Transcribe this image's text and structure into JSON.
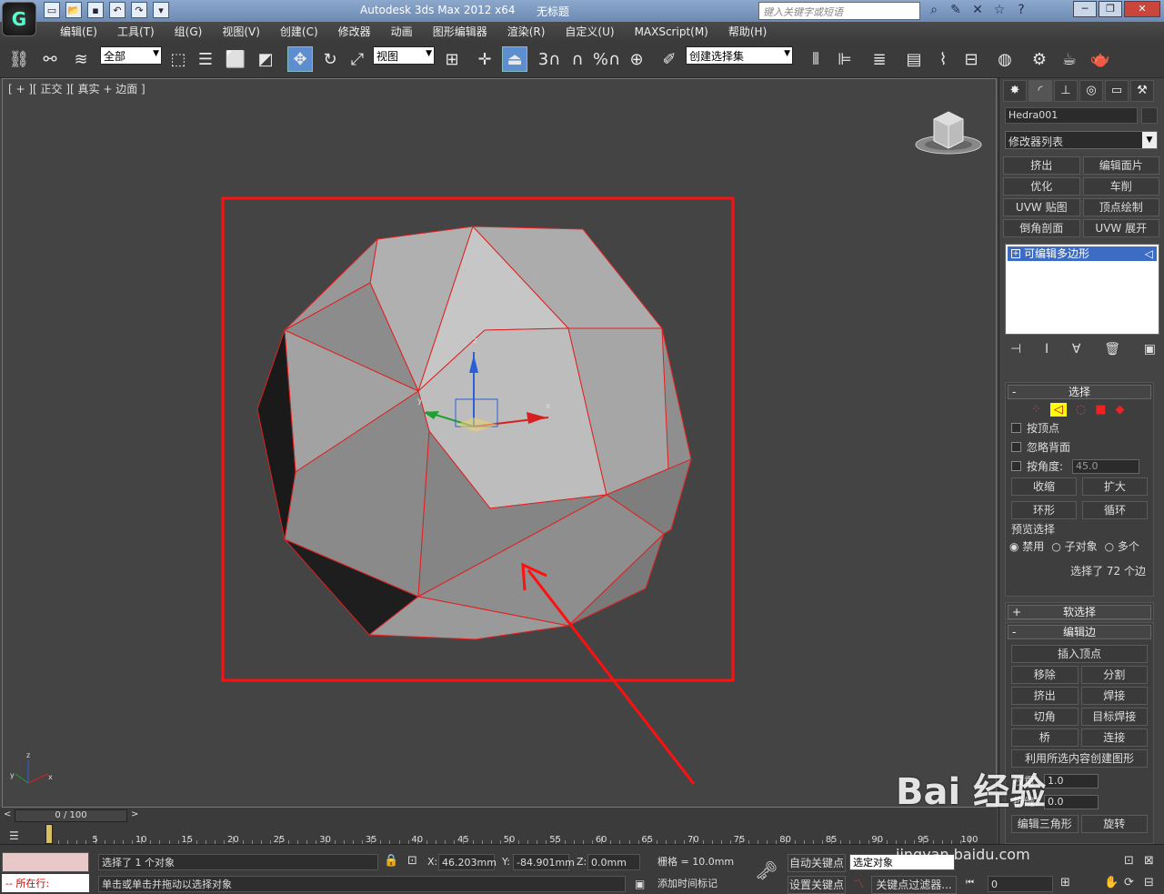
{
  "app": {
    "title": "Autodesk 3ds Max  2012 x64",
    "document": "无标题",
    "search_placeholder": "键入关键字或短语"
  },
  "menu": [
    "编辑(E)",
    "工具(T)",
    "组(G)",
    "视图(V)",
    "创建(C)",
    "修改器",
    "动画",
    "图形编辑器",
    "渲染(R)",
    "自定义(U)",
    "MAXScript(M)",
    "帮助(H)"
  ],
  "toolbar": {
    "filter": "全部",
    "refcoord": "视图",
    "selset": "创建选择集",
    "snap_num": "3",
    "angle": "%"
  },
  "viewport": {
    "label": "[ + ][ 正交 ][ 真实 + 边面 ]"
  },
  "panel": {
    "object_name": "Hedra001",
    "modifier_list": "修改器列表",
    "mod_buttons": [
      "挤出",
      "编辑面片",
      "优化",
      "车削",
      "UVW 贴图",
      "顶点绘制",
      "倒角剖面",
      "UVW 展开"
    ],
    "stack_item": "可编辑多边形",
    "selection": {
      "title": "选择",
      "by_vertex": "按顶点",
      "ignore_back": "忽略背面",
      "by_angle": "按角度:",
      "angle_value": "45.0",
      "shrink": "收缩",
      "grow": "扩大",
      "ring": "环形",
      "loop": "循环",
      "preview": "预览选择",
      "disable": "禁用",
      "subobj": "子对象",
      "multi": "多个",
      "status": "选择了 72 个边"
    },
    "soft_sel": "软选择",
    "edit_edges": {
      "title": "编辑边",
      "insert_vertex": "插入顶点",
      "remove": "移除",
      "split": "分割",
      "extrude": "挤出",
      "weld": "焊接",
      "chamfer": "切角",
      "target_weld": "目标焊接",
      "bridge": "桥",
      "connect": "连接",
      "create_shape": "利用所选内容创建图形",
      "weight": "权重:",
      "weight_value": "1.0",
      "crease": "折缝:",
      "crease_value": "0.0",
      "edit_tri": "编辑三角形",
      "turn": "旋转"
    }
  },
  "timeline": {
    "frame": "0 / 100",
    "ticks": [
      "0",
      "5",
      "10",
      "15",
      "20",
      "25",
      "30",
      "35",
      "40",
      "45",
      "50",
      "55",
      "60",
      "65",
      "70",
      "75",
      "80",
      "85",
      "90",
      "95",
      "100"
    ]
  },
  "status": {
    "selected": "选择了 1 个对象",
    "prompt": "单击或单击并拖动以选择对象",
    "current_label": "所在行:",
    "x": "46.203mm",
    "y": "-84.901mm",
    "z": "0.0mm",
    "grid": "栅格 = 10.0mm",
    "autokey": "自动关键点",
    "setkey": "设置关键点",
    "sel_obj": "选定对象",
    "key_filter": "关键点过滤器...",
    "add_tag": "添加时间标记",
    "frame_val": "0"
  },
  "watermark": {
    "logo": "Bai 经验",
    "url": "jingyan.baidu.com"
  }
}
